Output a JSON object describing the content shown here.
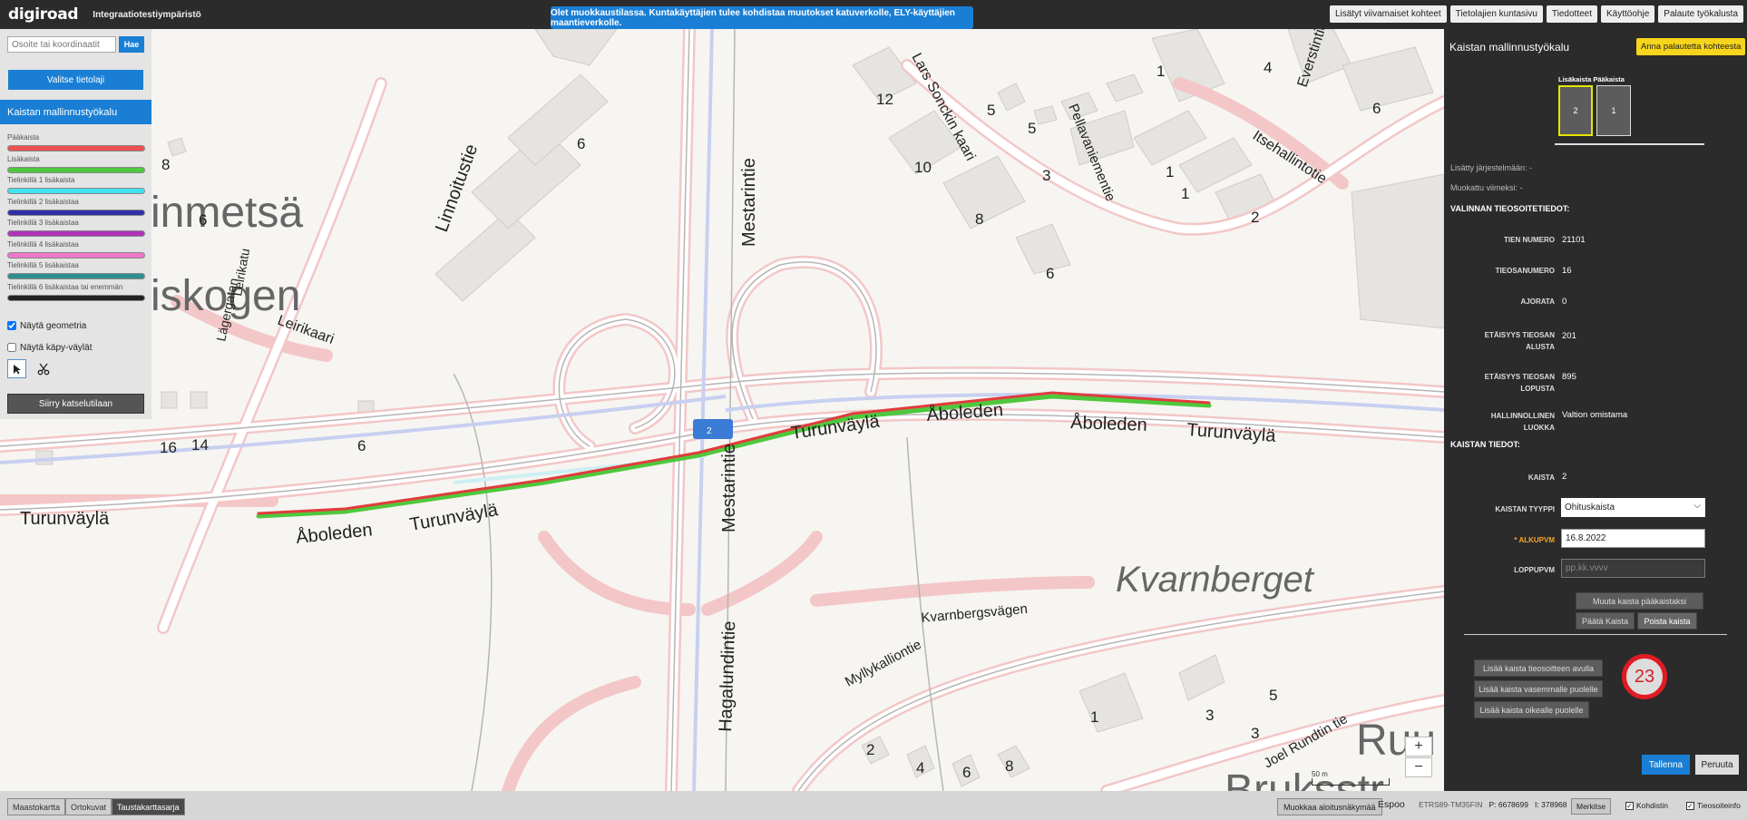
{
  "header": {
    "logo": "digiroad",
    "environment": "Integraatiotestiympäristö",
    "notice": "Olet muokkaustilassa. Kuntakäyttäjien tulee kohdistaa muutokset katuverkolle, ELY-käyttäjien maantieverkolle.",
    "links": [
      "Lisätyt viivamaiset kohteet",
      "Tietolajien kuntasivu",
      "Tiedotteet",
      "Käyttöohje",
      "Palaute työkalusta"
    ]
  },
  "sidebar": {
    "search_placeholder": "Osoite tai koordinaatit",
    "search_button": "Hae",
    "select_layer": "Valitse tietolaji",
    "tool_title": "Kaistan mallinnustyökalu",
    "legend": [
      {
        "label": "Pääkaista",
        "color": "#f05050"
      },
      {
        "label": "Lisäkaista",
        "color": "#4ec83c"
      },
      {
        "label": "Tielinkillä 1 lisäkaista",
        "color": "#41e1f0"
      },
      {
        "label": "Tielinkillä 2 lisäkaistaa",
        "color": "#2f2fa8"
      },
      {
        "label": "Tielinkillä 3 lisäkaistaa",
        "color": "#b033b8"
      },
      {
        "label": "Tielinkillä 4 lisäkaistaa",
        "color": "#f078c8"
      },
      {
        "label": "Tielinkillä 5 lisäkaistaa",
        "color": "#2f8f8f"
      },
      {
        "label": "Tielinkillä 6 lisäkaistaa tai enemmän",
        "color": "#222222"
      }
    ],
    "show_geometry": "Näytä geometria",
    "show_geometry_checked": true,
    "show_cycle_paths": "Näytä käpy-väylät",
    "show_cycle_paths_checked": false,
    "view_mode_button": "Siirry katselutilaan"
  },
  "map": {
    "place_labels": [
      "inmetsä",
      "iskogen",
      "Kvarnberget",
      "Ruu",
      "Bruksstr"
    ],
    "road_labels": [
      "Linnoitustie",
      "Leirikaari",
      "Lägergatan",
      "Leirikatu",
      "Mestarintie",
      "Lars Sonckin kaari",
      "Pellavaniementie",
      "Itsehallintotie",
      "Everstintie",
      "Turunväylä",
      "Åboleden",
      "Hagalundintie",
      "Myllykalliontie",
      "Kvarnbergsvägen",
      "Joel Rundtin tie"
    ],
    "building_numbers": [
      "6",
      "8",
      "6",
      "12",
      "5",
      "5",
      "10",
      "3",
      "8",
      "6",
      "1",
      "4",
      "6",
      "1",
      "1",
      "2",
      "16",
      "14",
      "6",
      "1",
      "3",
      "3",
      "5",
      "2",
      "4",
      "6",
      "8"
    ],
    "lane_marker": "2",
    "scale_label": "50 m",
    "zoom_in": "+",
    "zoom_out": "−"
  },
  "rightpanel": {
    "title": "Kaistan mallinnustyökalu",
    "feedback_button": "Anna palautetta kohteesta",
    "lane_header": "Lisäkaista Pääkaista",
    "lanes": [
      "2",
      "1"
    ],
    "added_to_system": "Lisätty järjestelmään: -",
    "last_modified": "Muokattu viimeksi: -",
    "road_address_section": "VALINNAN TIEOSOITETIEDOT:",
    "fields": [
      {
        "label": "TIEN NUMERO",
        "value": "21101"
      },
      {
        "label": "TIEOSANUMERO",
        "value": "16"
      },
      {
        "label": "AJORATA",
        "value": "0"
      },
      {
        "label": "ETÄISYYS TIEOSAN ALUSTA",
        "value": "201"
      },
      {
        "label": "ETÄISYYS TIEOSAN LOPUSTA",
        "value": "895"
      },
      {
        "label": "HALLINNOLLINEN LUOKKA",
        "value": "Valtion omistama"
      }
    ],
    "lane_info_section": "KAISTAN TIEDOT:",
    "lane_label": "KAISTA",
    "lane_value": "2",
    "lane_type_label": "KAISTAN TYYPPI",
    "lane_type_value": "Ohituskaista",
    "start_date_label": "* ALKUPVM",
    "start_date_value": "16.8.2022",
    "end_date_label": "LOPPUPVM",
    "end_date_placeholder": "pp.kk.vvvv",
    "make_main_lane": "Muuta kaista pääkaistaksi",
    "end_lane": "Päätä Kaista",
    "delete_lane": "Poista kaista",
    "add_by_address": "Lisää kaista tieosoitteen avulla",
    "add_left": "Lisää kaista vasemmalle puolelle",
    "add_right": "Lisää kaista oikealle puolelle",
    "badge": "23",
    "save": "Tallenna",
    "cancel": "Peruuta"
  },
  "footer": {
    "basemaps": [
      "Maastokartta",
      "Ortokuvat",
      "Taustakarttasarja"
    ],
    "active_basemap": "Taustakarttasarja",
    "edit_start": "Muokkaa aloitusnäkymää",
    "municipality": "Espoo",
    "coord_system": "ETRS89-TM35FIN",
    "coord_p": "P: 6678699",
    "coord_i": "I: 378968",
    "mark_button": "Merkitse",
    "target_label": "Kohdistin",
    "target_checked": true,
    "roadaddr_label": "Tieosoiteinfo",
    "roadaddr_checked": true
  },
  "colors": {
    "accent": "#1a7fd4",
    "main_lane": "#e03c3c",
    "additional_lane": "#4ec83c",
    "highlight": "#f7d51c",
    "badge_ring": "#e01b24"
  }
}
